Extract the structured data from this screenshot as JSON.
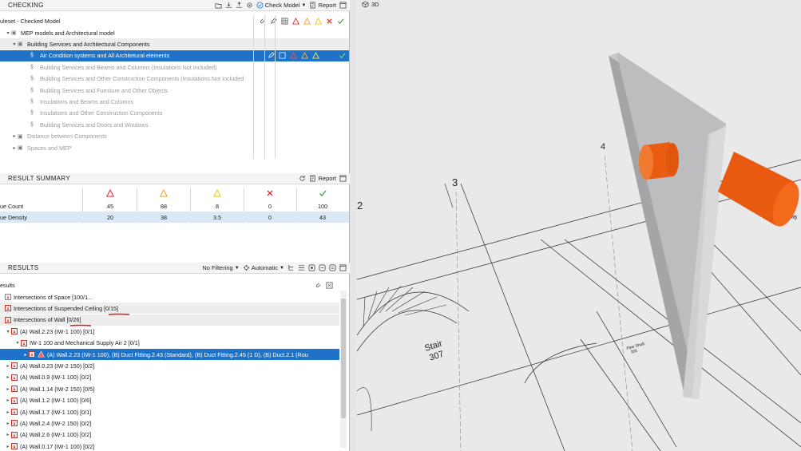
{
  "checking": {
    "title": "CHECKING",
    "check_model_label": "Check Model",
    "report_label": "Report",
    "ruleset_label": "uleset - Checked Model",
    "tree": [
      {
        "label": "MEP models and Architectural model",
        "level": 0,
        "state": "open",
        "style": "normal"
      },
      {
        "label": "Building Services and Architectural Components",
        "level": 1,
        "state": "open",
        "style": "gray"
      },
      {
        "label": "Air Condition systems and All Architetural elements",
        "level": 2,
        "state": "leaf",
        "style": "selected"
      },
      {
        "label": "Building Services and Beams and Columns (Insulations Not Included)",
        "level": 2,
        "state": "leaf",
        "style": "dim"
      },
      {
        "label": "Building Services and Other Construction Components (Insulations Not Included",
        "level": 2,
        "state": "leaf",
        "style": "dim"
      },
      {
        "label": "Building Services and Furniture and Other Objects",
        "level": 2,
        "state": "leaf",
        "style": "dim"
      },
      {
        "label": "Insulations and Beams and Columns",
        "level": 2,
        "state": "leaf",
        "style": "dim"
      },
      {
        "label": "Insulations and Other Construction Components",
        "level": 2,
        "state": "leaf",
        "style": "dim"
      },
      {
        "label": "Building Services and Doors and Windows",
        "level": 2,
        "state": "leaf",
        "style": "dim"
      },
      {
        "label": "Distance between Components",
        "level": 1,
        "state": "closed",
        "style": "dim"
      },
      {
        "label": "Spaces and MEP",
        "level": 1,
        "state": "closed",
        "style": "dim"
      }
    ]
  },
  "summary": {
    "title": "RESULT SUMMARY",
    "report_label": "Report",
    "rows": [
      {
        "label": "ue Count",
        "values": [
          "45",
          "88",
          "8",
          "0",
          "100"
        ]
      },
      {
        "label": "ue Density",
        "values": [
          "20",
          "38",
          "3.5",
          "0",
          "43"
        ]
      }
    ]
  },
  "results": {
    "title": "RESULTS",
    "filter_label": "No Filtering",
    "mode_label": "Automatic",
    "root_label": "esults",
    "items": [
      {
        "label": "Intersections of Space [100/1...",
        "level": 0,
        "state": "none",
        "style": "normal"
      },
      {
        "label": "Intersections of Suspended Ceiling [0/15]",
        "level": 0,
        "state": "none",
        "style": "gray"
      },
      {
        "label": "Intersections of Wall [0/26]",
        "level": 0,
        "state": "none",
        "style": "gray"
      },
      {
        "label": "(A) Wall.2.23 (IW-1 100) [0/1]",
        "level": 1,
        "state": "open",
        "style": "normal"
      },
      {
        "label": "IW-1 100 and Mechanical Supply Air 2 [0/1]",
        "level": 2,
        "state": "open",
        "style": "normal"
      },
      {
        "label": "(A) Wall.2.23 (IW-1 100), (B) Duct Fitting.2.43 (Standard), (B) Duct Fitting.2.45 (1 D), (B) Duct.2.1 (Rou",
        "level": 3,
        "state": "closed",
        "style": "selected"
      },
      {
        "label": "(A) Wall.0.23 (IW-2 150) [0/2]",
        "level": 1,
        "state": "closed",
        "style": "normal"
      },
      {
        "label": "(A) Wall.0.9 (IW-1 100) [0/2]",
        "level": 1,
        "state": "closed",
        "style": "normal"
      },
      {
        "label": "(A) Wall.1.14 (IW-2 150) [0/5]",
        "level": 1,
        "state": "closed",
        "style": "normal"
      },
      {
        "label": "(A) Wall.1.2 (IW-1 100) [0/6]",
        "level": 1,
        "state": "closed",
        "style": "normal"
      },
      {
        "label": "(A) Wall.1.7 (IW-1 100) [0/1]",
        "level": 1,
        "state": "closed",
        "style": "normal"
      },
      {
        "label": "(A) Wall.2.4 (IW-2 150) [0/2]",
        "level": 1,
        "state": "closed",
        "style": "normal"
      },
      {
        "label": "(A) Wall.2.6 (IW-1 100) [0/2]",
        "level": 1,
        "state": "closed",
        "style": "normal"
      },
      {
        "label": "(A) Wall.0.17 (IW-1 100) [0/2]",
        "level": 1,
        "state": "closed",
        "style": "normal"
      }
    ]
  },
  "viewport": {
    "title": "3D",
    "grid_labels": [
      "4",
      "3",
      "2"
    ],
    "stair_label": "Stair",
    "stair_number": "307",
    "pipe_shaft_label": "Pipe Shaft",
    "pipe_shaft_number": "305",
    "edge_label": "Offi"
  },
  "colors": {
    "selection": "#1e73c8",
    "duct": "#f26419",
    "error": "#e0252b",
    "warning_orange": "#f29d0a",
    "warning_yellow": "#e5c800",
    "ok": "#3aa843"
  }
}
